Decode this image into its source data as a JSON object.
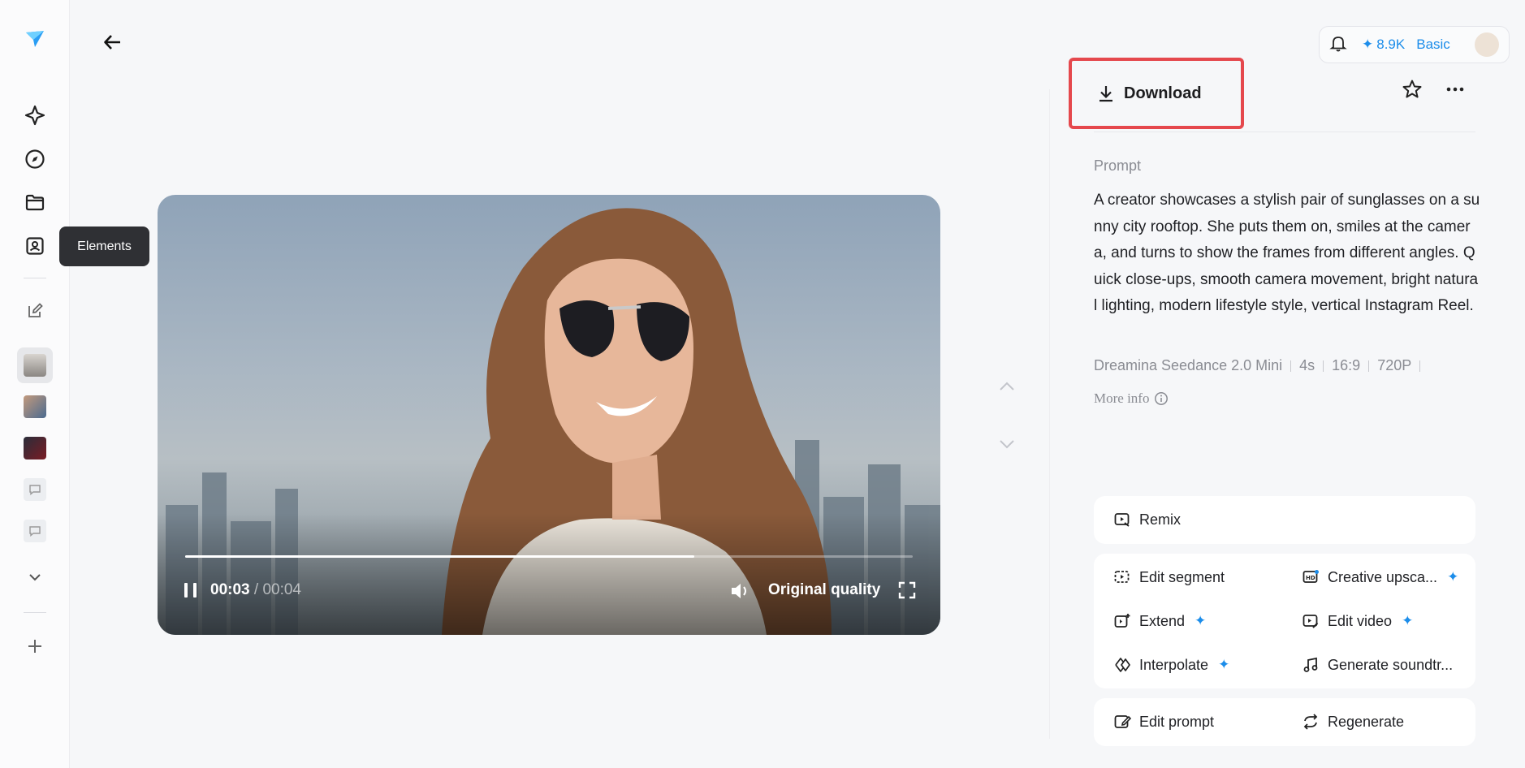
{
  "sidebar": {
    "tooltip": "Elements",
    "icons": [
      "logo-icon",
      "sparkle-icon",
      "compass-icon",
      "folder-icon",
      "elements-icon",
      "edit-icon"
    ]
  },
  "player": {
    "current_time": "00:03",
    "duration": "/ 00:04",
    "progress_fraction": 0.7,
    "quality": "Original quality"
  },
  "topbar": {
    "credits": "8.9K",
    "plan": "Basic"
  },
  "download": {
    "label": "Download"
  },
  "prompt": {
    "label": "Prompt",
    "text": "A creator showcases a stylish pair of sunglasses on a sunny city rooftop. She puts them on, smiles at the camera, and turns to show the frames from different angles. Quick close-ups, smooth camera movement, bright natural lighting, modern lifestyle style, vertical Instagram Reel.",
    "model": "Dreamina Seedance 2.0 Mini",
    "duration": "4s",
    "ratio": "16:9",
    "resolution": "720P",
    "more_info": "More info"
  },
  "actions": {
    "remix": "Remix",
    "edit_segment": "Edit segment",
    "creative_upscale": "Creative upsca...",
    "extend": "Extend",
    "edit_video": "Edit video",
    "interpolate": "Interpolate",
    "generate_soundtrack": "Generate soundtr...",
    "edit_prompt": "Edit prompt",
    "regenerate": "Regenerate"
  },
  "colors": {
    "accent": "#1c8dea",
    "highlight": "#e5484d"
  }
}
